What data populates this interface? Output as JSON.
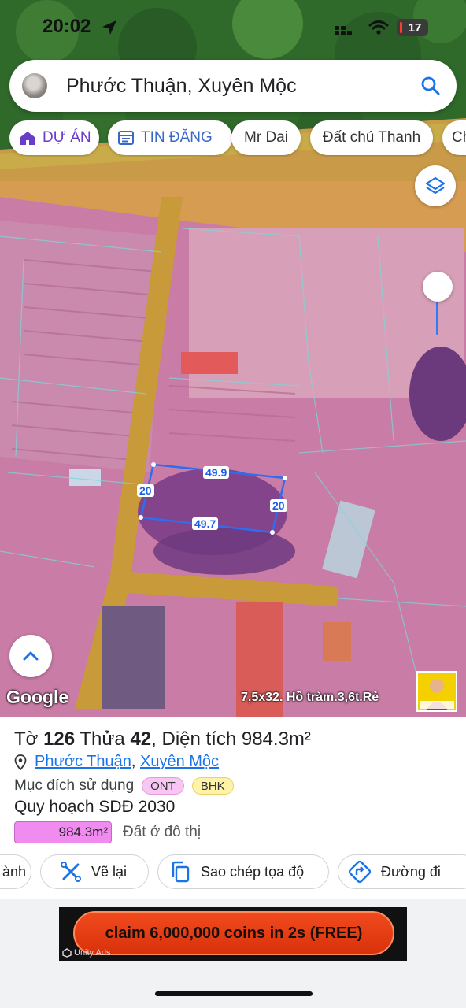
{
  "status_bar": {
    "time": "20:02",
    "battery": "17",
    "icons": [
      "location-arrow-icon",
      "signal-icon",
      "wifi-icon",
      "battery-icon"
    ]
  },
  "search": {
    "value": "Phước Thuận, Xuyên Mộc",
    "icon": "search-icon"
  },
  "chips": [
    {
      "label": "DỰ ÁN",
      "icon": "house-icon"
    },
    {
      "label": "TIN ĐĂNG",
      "icon": "listing-icon"
    },
    {
      "label": "Mr Dai"
    },
    {
      "label": "Đất chú Thanh"
    },
    {
      "label": "Ch"
    }
  ],
  "map": {
    "measurements": {
      "top": "49.9",
      "bottom": "49.7",
      "left": "20",
      "right": "20"
    },
    "logo": "Google",
    "caption": "7,5x32. Hồ tràm.3,6t.Rẻ",
    "slider_level": 0.0
  },
  "parcel": {
    "title_prefix": "Tờ",
    "sheet": "126",
    "lot_prefix": "Thửa",
    "lot": "42",
    "area_prefix": ", Diện tích",
    "area": "984.3m²",
    "ward": "Phước Thuận",
    "separator": ",",
    "district": "Xuyên Mộc",
    "usage_label": "Mục đích sử dụng",
    "usage_badges": [
      "ONT",
      "BHK"
    ],
    "plan_title": "Quy hoạch SDĐ 2030",
    "plan_area": "984.3m²",
    "plan_label": "Đất ở đô thị"
  },
  "actions": [
    {
      "label": "ành"
    },
    {
      "label": "Vẽ lại",
      "icon": "redraw-icon"
    },
    {
      "label": "Sao chép tọa độ",
      "icon": "copy-icon"
    },
    {
      "label": "Đường đi",
      "icon": "directions-icon"
    }
  ],
  "ad": {
    "text": "claim 6,000,000 coins in 2s  (FREE)",
    "brand": "Unity Ads"
  },
  "colors": {
    "accent": "#1a73e8",
    "ont": "#f7c6f2",
    "bhk": "#fff3a8",
    "plan_fill": "#f08cf0",
    "measure": "#1b5fe6"
  }
}
